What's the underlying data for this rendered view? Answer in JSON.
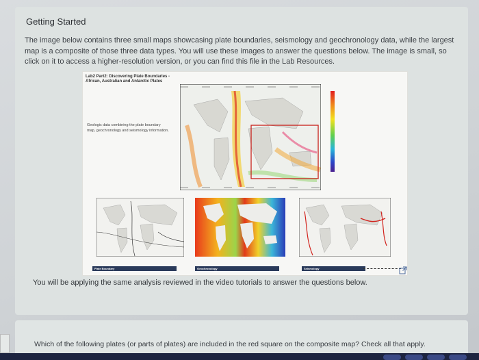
{
  "page": {
    "title": "Getting Started",
    "intro": "The image below contains three small maps showcasing plate boundaries, seismology and geochronology data, while the largest map is a composite of those three data types. You will use these images to answer the questions below. The image is small, so click on it to access a higher-resolution version, or you can find this file in the Lab Resources.",
    "caption": "You will be applying the same analysis reviewed in the video tutorials to answer the questions below.",
    "question": "Which of the following plates (or parts of plates) are included in the red square on the composite map? Check all that apply."
  },
  "lab_image": {
    "title_line1": "Lab2 Part2: Discovering Plate Boundaries -",
    "title_line2": "African, Australian and Antarctic Plates",
    "description": "Geologic data combining the plate boundary map, geochronology and seismology information.",
    "tag_plate": "Plate Boundary",
    "tag_geo": "Geochronology",
    "tag_seis": "Seismology"
  },
  "icons": {
    "external_link": "external-link-icon"
  },
  "colors": {
    "red_square": "#c8211b",
    "accent_text": "#2c2f33"
  }
}
